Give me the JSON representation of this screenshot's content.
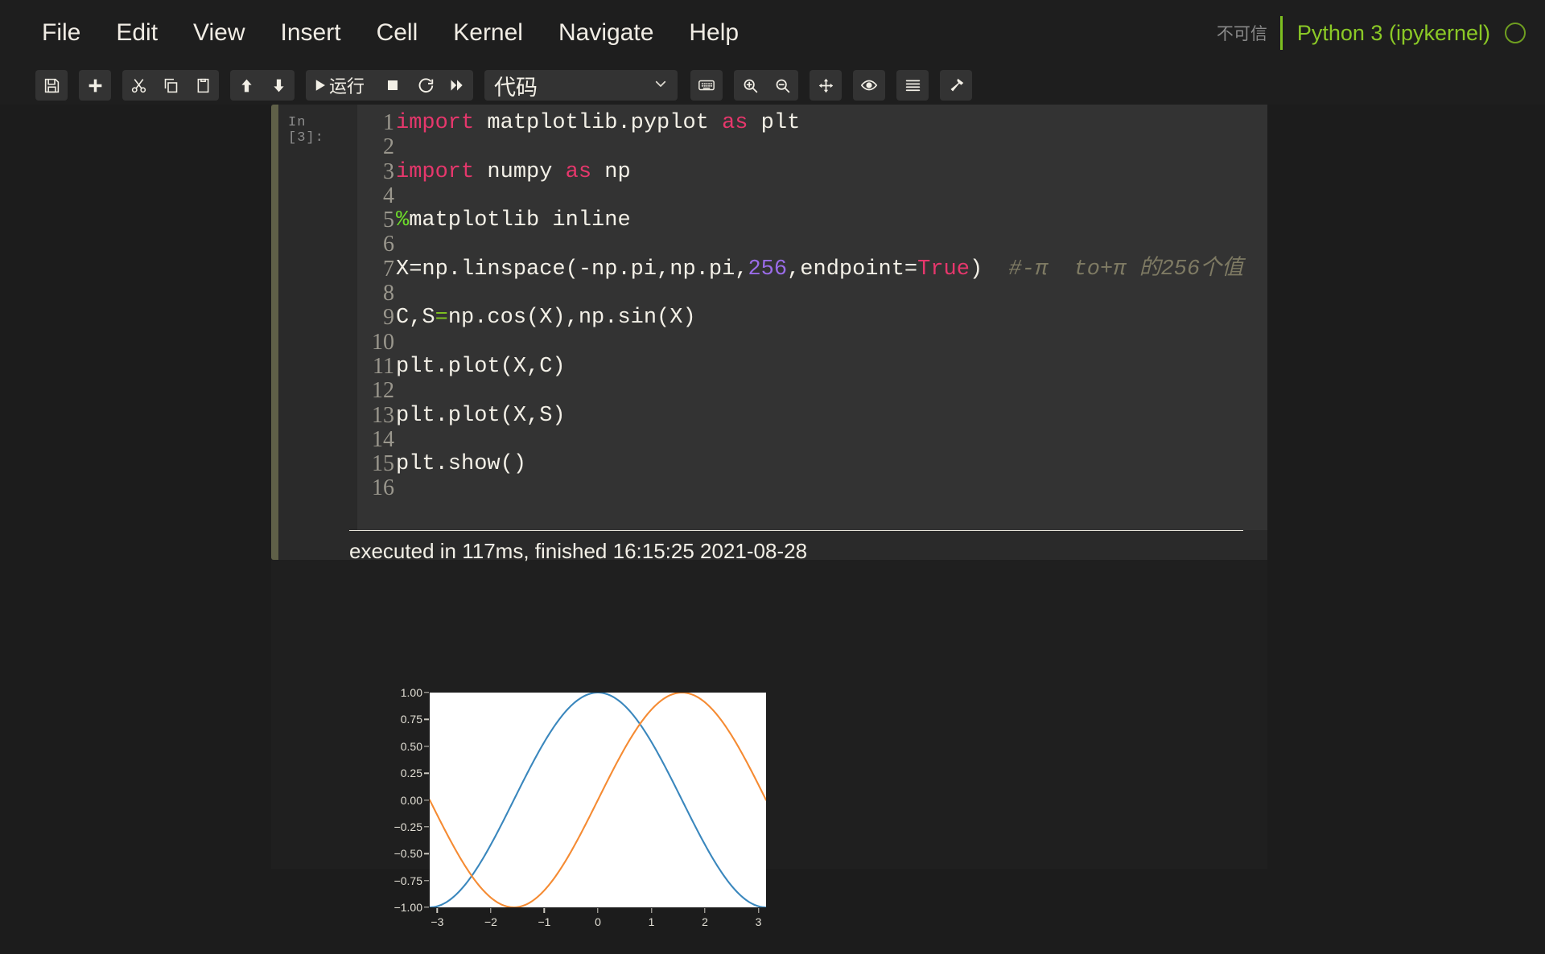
{
  "menu": {
    "items": [
      {
        "label": "File",
        "name": "menu-file"
      },
      {
        "label": "Edit",
        "name": "menu-edit"
      },
      {
        "label": "View",
        "name": "menu-view"
      },
      {
        "label": "Insert",
        "name": "menu-insert"
      },
      {
        "label": "Cell",
        "name": "menu-cell"
      },
      {
        "label": "Kernel",
        "name": "menu-kernel"
      },
      {
        "label": "Navigate",
        "name": "menu-navigate"
      },
      {
        "label": "Help",
        "name": "menu-help"
      }
    ],
    "trust_label": "不可信",
    "kernel_name": "Python 3 (ipykernel)",
    "kernel_status": "idle"
  },
  "toolbar": {
    "run_label": "运行",
    "cell_type": "代码",
    "buttons": [
      "save-icon",
      "add-cell-icon",
      "cut-icon",
      "copy-icon",
      "paste-icon",
      "move-up-icon",
      "move-down-icon",
      "run-icon",
      "stop-icon",
      "restart-icon",
      "restart-run-all-icon",
      "keyboard-icon",
      "zoom-in-icon",
      "zoom-out-icon",
      "move-icon",
      "eye-icon",
      "list-icon",
      "hammer-icon"
    ]
  },
  "cell": {
    "prompt": "In  [3]:",
    "line_numbers": [
      "1",
      "2",
      "3",
      "4",
      "5",
      "6",
      "7",
      "8",
      "9",
      "10",
      "11",
      "12",
      "13",
      "14",
      "15",
      "16"
    ],
    "code_lines": [
      [
        {
          "t": "import",
          "c": "kw"
        },
        {
          "t": " matplotlib.pyplot ",
          "c": ""
        },
        {
          "t": "as",
          "c": "kw"
        },
        {
          "t": " plt",
          "c": ""
        }
      ],
      [],
      [
        {
          "t": "import",
          "c": "kw"
        },
        {
          "t": " numpy ",
          "c": ""
        },
        {
          "t": "as",
          "c": "kw"
        },
        {
          "t": " np",
          "c": ""
        }
      ],
      [],
      [
        {
          "t": "%",
          "c": "mag"
        },
        {
          "t": "matplotlib inline",
          "c": ""
        }
      ],
      [],
      [
        {
          "t": "X=np.linspace(-np.pi,np.pi,",
          "c": ""
        },
        {
          "t": "256",
          "c": "num"
        },
        {
          "t": ",endpoint=",
          "c": ""
        },
        {
          "t": "True",
          "c": "kw"
        },
        {
          "t": ")",
          "c": ""
        },
        {
          "t": "  #-π  to+π 的256个值",
          "c": "cmt"
        }
      ],
      [],
      [
        {
          "t": "C,S",
          "c": ""
        },
        {
          "t": "=",
          "c": "op"
        },
        {
          "t": "np.cos(X),np.sin(X)",
          "c": ""
        }
      ],
      [],
      [
        {
          "t": "plt.plot(X,C)",
          "c": ""
        }
      ],
      [],
      [
        {
          "t": "plt.plot(X,S)",
          "c": ""
        }
      ],
      [],
      [
        {
          "t": "plt.show()",
          "c": ""
        }
      ],
      []
    ],
    "execution_info": "executed in 117ms, finished 16:15:25 2021-08-28"
  },
  "chart_data": {
    "type": "line",
    "title": "",
    "xlabel": "",
    "ylabel": "",
    "xlim": [
      -3.141592653589793,
      3.141592653589793
    ],
    "ylim": [
      -1.0,
      1.0
    ],
    "grid": false,
    "legend": "none",
    "xticks": [
      "−3",
      "−2",
      "−1",
      "0",
      "1",
      "2",
      "3"
    ],
    "xtick_values": [
      -3,
      -2,
      -1,
      0,
      1,
      2,
      3
    ],
    "yticks": [
      "1.00",
      "0.75",
      "0.50",
      "0.25",
      "0.00",
      "−0.25",
      "−0.50",
      "−0.75",
      "−1.00"
    ],
    "ytick_values": [
      1.0,
      0.75,
      0.5,
      0.25,
      0.0,
      -0.25,
      -0.5,
      -0.75,
      -1.0
    ],
    "n_points": 256,
    "series": [
      {
        "name": "cos(X)",
        "color": "#3a87bd",
        "func": "cos"
      },
      {
        "name": "sin(X)",
        "color": "#f58b33",
        "func": "sin"
      }
    ]
  },
  "colors": {
    "page_bg": "#1c1c1c",
    "notebook_bg": "#1f1f1f",
    "cell_bg": "#2a2a2a",
    "editor_bg": "#333333",
    "selection_bar": "#5f6048",
    "kernel_green": "#8bc926",
    "keyword_pink": "#e6376c",
    "number_purple": "#9a6ce8",
    "magic_green": "#6ddb2a",
    "comment_olive": "#7e7a63"
  }
}
